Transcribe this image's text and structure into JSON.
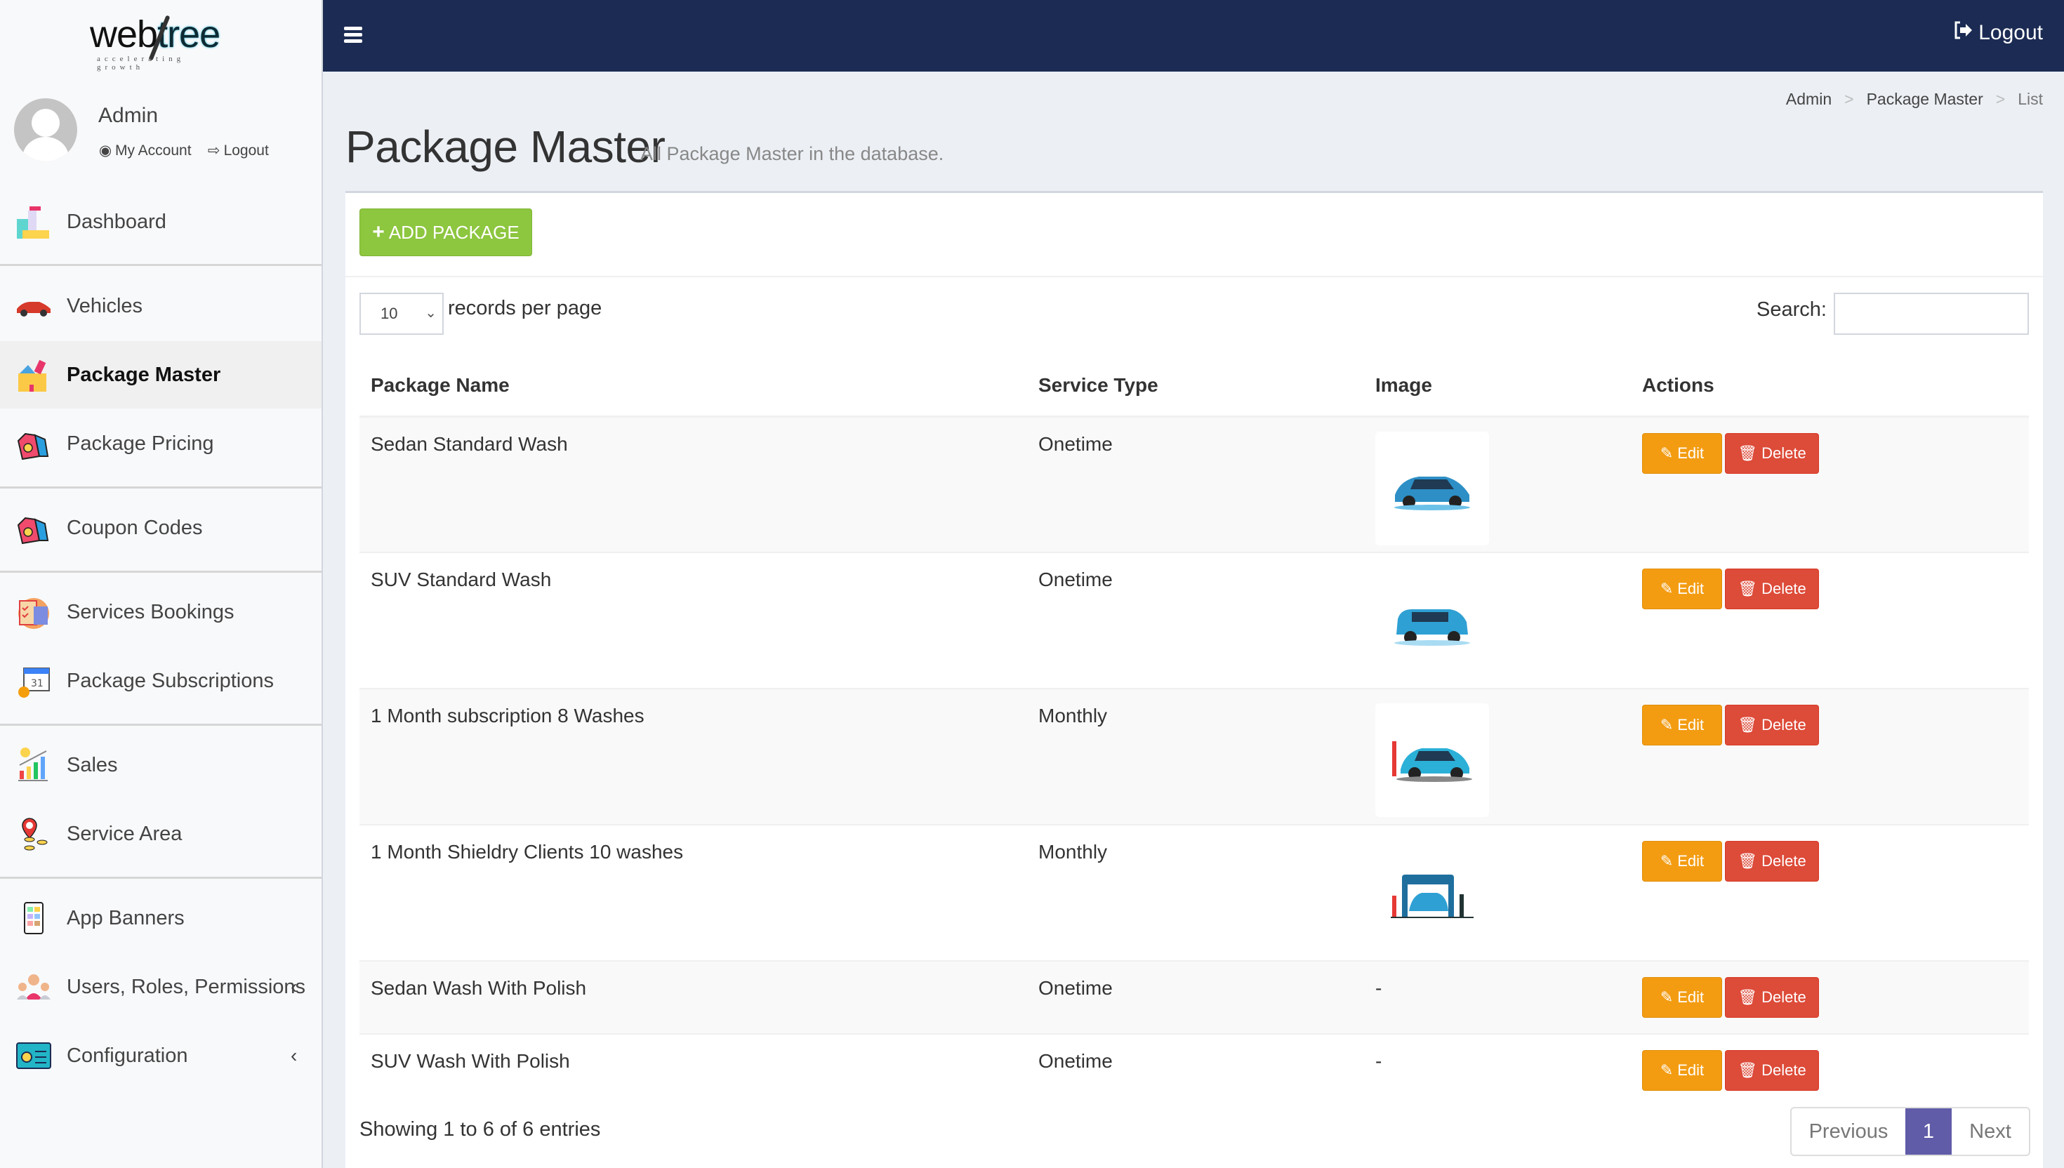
{
  "brand": {
    "name_part1": "web",
    "name_part2": "tree",
    "tagline": "accelerating growth"
  },
  "user": {
    "name": "Admin",
    "my_account": "My Account",
    "logout": "Logout"
  },
  "sidebar": {
    "items": [
      {
        "label": "Dashboard",
        "icon": "dashboard-cleaning-icon"
      },
      {
        "label": "Vehicles",
        "icon": "car-icon"
      },
      {
        "label": "Package Master",
        "icon": "package-box-icon",
        "active": true
      },
      {
        "label": "Package Pricing",
        "icon": "price-tag-icon"
      },
      {
        "label": "Coupon Codes",
        "icon": "coupon-tag-icon"
      },
      {
        "label": "Services Bookings",
        "icon": "clipboard-checklist-icon"
      },
      {
        "label": "Package Subscriptions",
        "icon": "calendar-coin-icon"
      },
      {
        "label": "Sales",
        "icon": "sales-chart-icon"
      },
      {
        "label": "Service Area",
        "icon": "map-pin-icon"
      },
      {
        "label": "App Banners",
        "icon": "mobile-app-icon"
      },
      {
        "label": "Users, Roles, Permissions",
        "icon": "users-group-icon",
        "chevron": "‹"
      },
      {
        "label": "Configuration",
        "icon": "settings-panel-icon",
        "chevron": "‹"
      }
    ]
  },
  "header": {
    "logout": "Logout"
  },
  "breadcrumb": [
    "Admin",
    "Package Master",
    "List"
  ],
  "breadcrumb_sep": ">",
  "page": {
    "title": "Package Master",
    "subtitle": "All Package Master in the database."
  },
  "toolbar": {
    "add_label": "ADD PACKAGE"
  },
  "table_controls": {
    "page_length": "10",
    "page_length_label": "records per page",
    "search_label": "Search:",
    "search_value": ""
  },
  "table": {
    "columns": [
      "Package Name",
      "Service Type",
      "Image",
      "Actions"
    ],
    "rows": [
      {
        "name": "Sedan Standard Wash",
        "type": "Onetime",
        "image": "sedan-wash-image"
      },
      {
        "name": "SUV Standard Wash",
        "type": "Onetime",
        "image": "suv-wash-image"
      },
      {
        "name": "1 Month subscription 8 Washes",
        "type": "Monthly",
        "image": "monthly-wash-image"
      },
      {
        "name": "1 Month Shieldry Clients 10 washes",
        "type": "Monthly",
        "image": "carwash-station-image"
      },
      {
        "name": "Sedan Wash With Polish",
        "type": "Onetime",
        "image": "-"
      },
      {
        "name": "SUV Wash With Polish",
        "type": "Onetime",
        "image": "-"
      }
    ],
    "edit_label": "Edit",
    "delete_label": "Delete"
  },
  "footer": {
    "info": "Showing 1 to 6 of 6 entries",
    "prev": "Previous",
    "current_page": "1",
    "next": "Next"
  },
  "colors": {
    "topbar": "#1b2b53",
    "add_button": "#8dc63f",
    "edit_button": "#f39c12",
    "delete_button": "#dd4b39",
    "pager_active": "#605ca8"
  }
}
